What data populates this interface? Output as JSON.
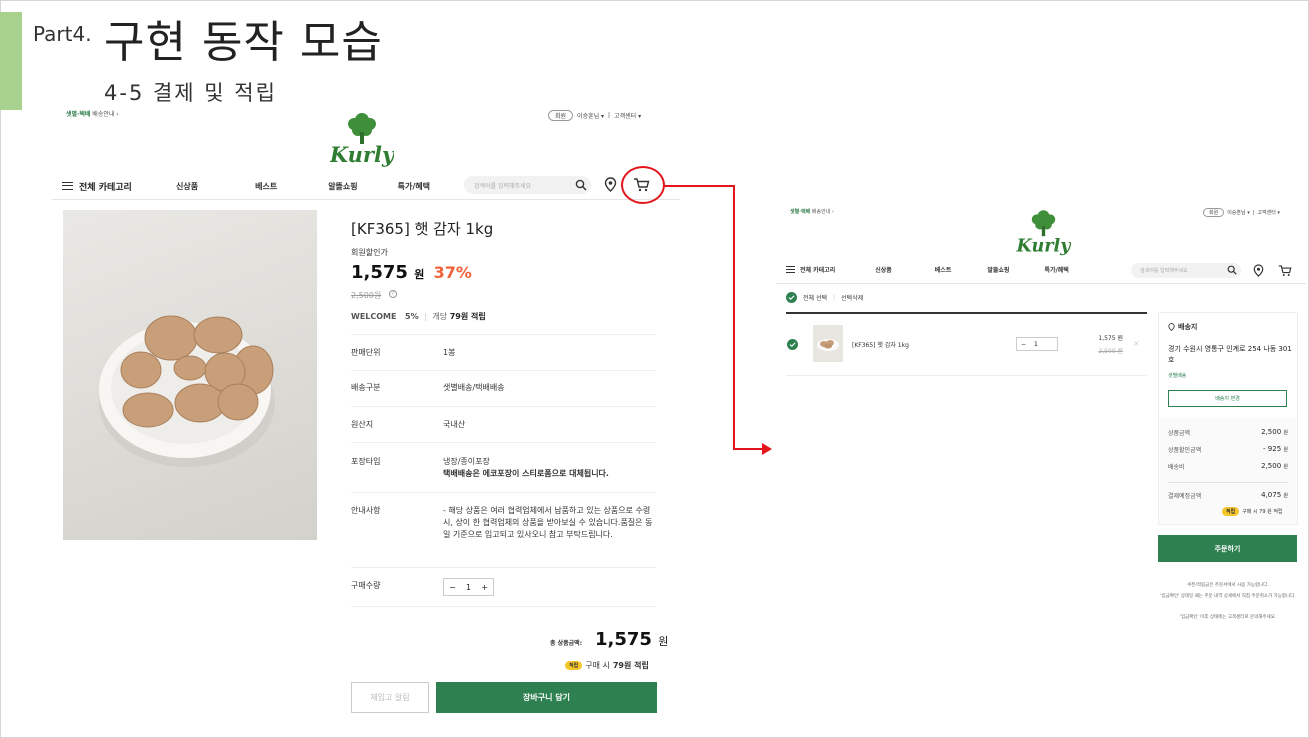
{
  "slide": {
    "part": "Part4.",
    "title": "구현 동작 모습",
    "subtitle": "4-5 결제 및 적립"
  },
  "product_page": {
    "delivery_banner": {
      "highlight": "샛별·택배",
      "rest": "배송안내 ›"
    },
    "top_links": {
      "signup": "회원",
      "user": "이승훈님 ▾",
      "service": "고객센터 ▾"
    },
    "nav": {
      "menu_label": "전체 카테고리",
      "items": [
        "신상품",
        "베스트",
        "알뜰쇼핑",
        "특가/혜택"
      ],
      "search_placeholder": "검색어를 입력해주세요"
    },
    "product": {
      "name": "[KF365] 햇 감자 1kg",
      "member_label": "회원할인가",
      "price": "1,575",
      "price_unit": "원",
      "discount_rate": "37%",
      "original_price": "2,500원",
      "welcome_label": "WELCOME",
      "welcome_rate": "5%",
      "earn_prefix": "개당",
      "earn_amount": "79원 적립",
      "info": [
        {
          "key": "판매단위",
          "value": "1봉"
        },
        {
          "key": "배송구분",
          "value": "샛별배송/택배배송"
        },
        {
          "key": "원산지",
          "value": "국내산"
        },
        {
          "key": "포장타입",
          "value": "냉장/종이포장",
          "value_bold": "택배배송은 에코포장이 스티로폼으로 대체됩니다."
        },
        {
          "key": "안내사항",
          "value": "- 해당 상품은 여러 협력업체에서 납품하고 있는 상품으로 수령시, 상이 한 협력업체의 상품을 받아보실 수 있습니다.품질은 동일 기준으로 입고되고 있사오니 참고 부탁드립니다."
        },
        {
          "key": "구매수량",
          "value": ""
        }
      ],
      "quantity": "1",
      "qty_minus": "−",
      "qty_plus": "+"
    },
    "total_label": "총 상품금액:",
    "total_price": "1,575",
    "total_unit": "원",
    "earn_badge": "적립",
    "earn_text_prefix": "구매 시",
    "earn_text_amount": "79원 적립",
    "restock_button": "재입고 알림",
    "add_to_cart_button": "장바구니 담기"
  },
  "cart_page": {
    "delivery_banner": {
      "highlight": "샛별·택배",
      "rest": "배송안내 ›"
    },
    "top_links": {
      "signup": "회원",
      "user": "이승훈님 ▾",
      "service": "고객센터 ▾"
    },
    "nav": {
      "menu_label": "전체 카테고리",
      "items": [
        "신상품",
        "베스트",
        "알뜰쇼핑",
        "특가/혜택"
      ],
      "search_placeholder": "검색어를 입력해주세요"
    },
    "select_all": "전체 선택",
    "delete_selected": "선택삭제",
    "item": {
      "name": "[KF365] 햇 감자 1kg",
      "quantity": "1",
      "qty_minus": "−",
      "price": "1,575 원",
      "original_price": "2,500 원"
    },
    "delivery": {
      "title": "배송지",
      "address": "경기 수원시 영통구 인계로 254 나동 301호",
      "type": "샛별배송",
      "change_button": "배송지 변경"
    },
    "summary": [
      {
        "label": "상품금액",
        "value": "2,500",
        "unit": "원"
      },
      {
        "label": "상품할인금액",
        "value": "- 925",
        "unit": "원"
      },
      {
        "label": "배송비",
        "value": "2,500",
        "unit": "원"
      }
    ],
    "expected": {
      "label": "결제예정금액",
      "value": "4,075",
      "unit": "원"
    },
    "earn_badge": "적립",
    "earn_text": "구매 시 79 원 적립",
    "order_button": "주문하기",
    "notes": [
      "쿠폰/적립금은 주문서에서 사용 가능합니다.",
      "'입금확인' 상태일 때는 주문 내역 상세에서 직접 주문취소가 가능합니다.",
      "'입금확인' 이후 상태에는 고객센터로 문의해주세요."
    ]
  },
  "colors": {
    "brand_green": "#2e8050",
    "accent_red": "#e3141b",
    "discount_orange": "#f0623a",
    "earn_yellow": "#f6c62b",
    "slide_bar_green": "#a9d18e"
  }
}
